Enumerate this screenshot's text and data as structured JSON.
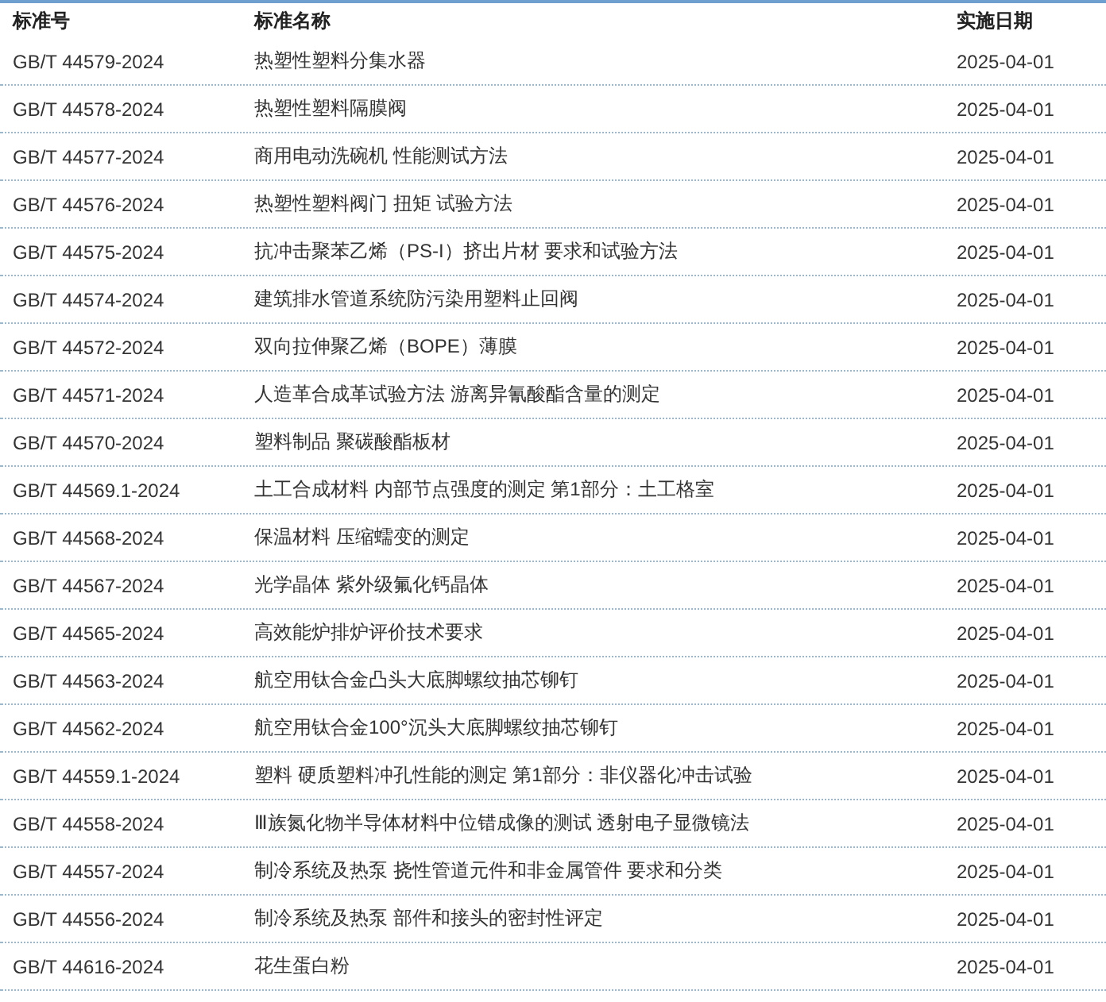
{
  "table": {
    "columns": [
      "标准号",
      "标准名称",
      "实施日期"
    ],
    "rows": [
      {
        "code": "GB/T 44579-2024",
        "name": "热塑性塑料分集水器",
        "date": "2025-04-01"
      },
      {
        "code": "GB/T 44578-2024",
        "name": "热塑性塑料隔膜阀",
        "date": "2025-04-01"
      },
      {
        "code": "GB/T 44577-2024",
        "name": "商用电动洗碗机 性能测试方法",
        "date": "2025-04-01"
      },
      {
        "code": "GB/T 44576-2024",
        "name": "热塑性塑料阀门 扭矩 试验方法",
        "date": "2025-04-01"
      },
      {
        "code": "GB/T 44575-2024",
        "name": "抗冲击聚苯乙烯（PS-I）挤出片材 要求和试验方法",
        "date": "2025-04-01"
      },
      {
        "code": "GB/T 44574-2024",
        "name": "建筑排水管道系统防污染用塑料止回阀",
        "date": "2025-04-01"
      },
      {
        "code": "GB/T 44572-2024",
        "name": "双向拉伸聚乙烯（BOPE）薄膜",
        "date": "2025-04-01"
      },
      {
        "code": "GB/T 44571-2024",
        "name": "人造革合成革试验方法 游离异氰酸酯含量的测定",
        "date": "2025-04-01"
      },
      {
        "code": "GB/T 44570-2024",
        "name": "塑料制品 聚碳酸酯板材",
        "date": "2025-04-01"
      },
      {
        "code": "GB/T 44569.1-2024",
        "name": "土工合成材料 内部节点强度的测定 第1部分：土工格室",
        "date": "2025-04-01"
      },
      {
        "code": "GB/T 44568-2024",
        "name": "保温材料 压缩蠕变的测定",
        "date": "2025-04-01"
      },
      {
        "code": "GB/T 44567-2024",
        "name": "光学晶体 紫外级氟化钙晶体",
        "date": "2025-04-01"
      },
      {
        "code": "GB/T 44565-2024",
        "name": "高效能炉排炉评价技术要求",
        "date": "2025-04-01"
      },
      {
        "code": "GB/T 44563-2024",
        "name": "航空用钛合金凸头大底脚螺纹抽芯铆钉",
        "date": "2025-04-01"
      },
      {
        "code": "GB/T 44562-2024",
        "name": "航空用钛合金100°沉头大底脚螺纹抽芯铆钉",
        "date": "2025-04-01"
      },
      {
        "code": "GB/T 44559.1-2024",
        "name": "塑料 硬质塑料冲孔性能的测定 第1部分：非仪器化冲击试验",
        "date": "2025-04-01"
      },
      {
        "code": "GB/T 44558-2024",
        "name": "Ⅲ族氮化物半导体材料中位错成像的测试 透射电子显微镜法",
        "date": "2025-04-01"
      },
      {
        "code": "GB/T 44557-2024",
        "name": "制冷系统及热泵 挠性管道元件和非金属管件 要求和分类",
        "date": "2025-04-01"
      },
      {
        "code": "GB/T 44556-2024",
        "name": "制冷系统及热泵 部件和接头的密封性评定",
        "date": "2025-04-01"
      },
      {
        "code": "GB/T 44616-2024",
        "name": "花生蛋白粉",
        "date": "2025-04-01"
      }
    ]
  }
}
